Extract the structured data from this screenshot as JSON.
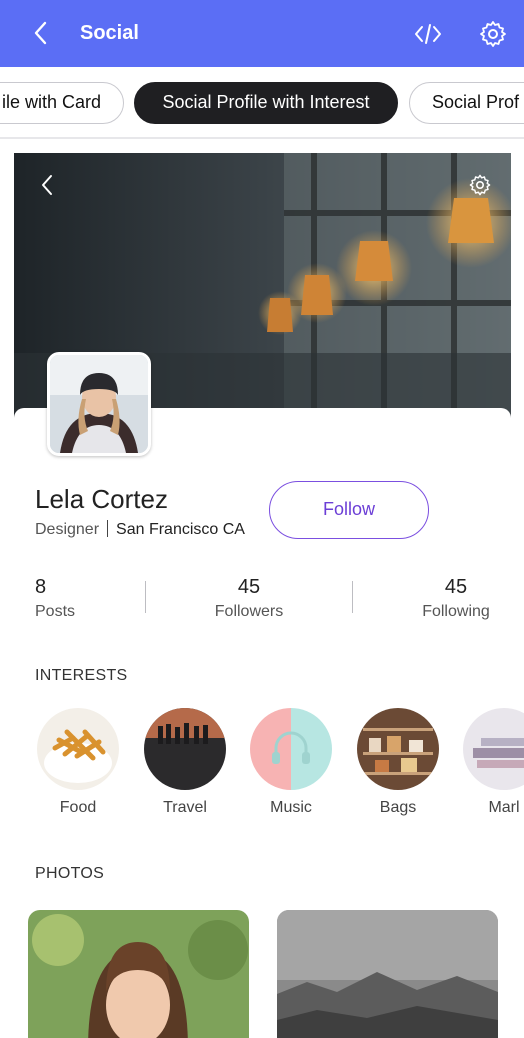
{
  "appbar": {
    "title": "Social",
    "back_icon": "chevron-left-icon",
    "code_icon": "code-icon",
    "settings_icon": "gear-icon",
    "color": "#5b6ef5"
  },
  "tabs": [
    {
      "label": "ile with Card",
      "selected": false
    },
    {
      "label": "Social Profile with Interest",
      "selected": true
    },
    {
      "label": "Social Prof",
      "selected": false
    }
  ],
  "profile": {
    "name": "Lela Cortez",
    "role": "Designer",
    "location": "San Francisco CA",
    "follow_label": "Follow",
    "accent": "#6c3fd6"
  },
  "stats": [
    {
      "value": "8",
      "label": "Posts"
    },
    {
      "value": "45",
      "label": "Followers"
    },
    {
      "value": "45",
      "label": "Following"
    }
  ],
  "interests_title": "INTERESTS",
  "interests": [
    {
      "label": "Food"
    },
    {
      "label": "Travel"
    },
    {
      "label": "Music"
    },
    {
      "label": "Bags"
    },
    {
      "label": "Marl"
    }
  ],
  "photos_title": "PHOTOS"
}
